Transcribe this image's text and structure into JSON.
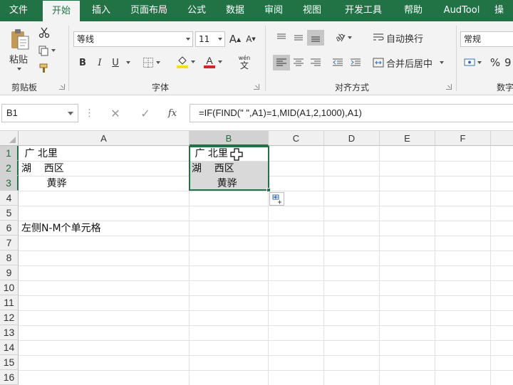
{
  "tabs": [
    {
      "label": "文件",
      "active": false
    },
    {
      "label": "开始",
      "active": true
    },
    {
      "label": "插入",
      "active": false
    },
    {
      "label": "页面布局",
      "active": false
    },
    {
      "label": "公式",
      "active": false
    },
    {
      "label": "数据",
      "active": false
    },
    {
      "label": "审阅",
      "active": false
    },
    {
      "label": "视图",
      "active": false
    },
    {
      "label": "开发工具",
      "active": false
    },
    {
      "label": "帮助",
      "active": false
    },
    {
      "label": "AudTool",
      "active": false
    },
    {
      "label": "操",
      "active": false
    }
  ],
  "ribbon": {
    "clipboard": {
      "paste_label": "粘贴",
      "group_label": "剪贴板"
    },
    "font": {
      "font_name": "等线",
      "font_size": "11",
      "bold": "B",
      "italic": "I",
      "underline": "U",
      "wen_top": "wén",
      "wen_bottom": "文",
      "increase_font": "A",
      "decrease_font": "A",
      "group_label": "字体"
    },
    "alignment": {
      "wrap_text": "自动换行",
      "merge_center": "合并后居中",
      "group_label": "对齐方式"
    },
    "number": {
      "format": "常规",
      "percent": "%",
      "comma": "9",
      "group_label": "数字"
    }
  },
  "formula_bar": {
    "name_box": "B1",
    "cancel": "✕",
    "confirm": "✓",
    "fx": "fx",
    "formula": "=IF(FIND(\" \",A1)=1,MID(A1,2,1000),A1)"
  },
  "sheet": {
    "columns": [
      "A",
      "B",
      "C",
      "D",
      "E",
      "F"
    ],
    "selected_column": "B",
    "rows": [
      "1",
      "2",
      "3",
      "4",
      "5",
      "6",
      "7",
      "8",
      "9",
      "10",
      "11",
      "12",
      "13",
      "14",
      "15",
      "16"
    ],
    "selected_rows": [
      "1",
      "2",
      "3"
    ],
    "cells": {
      "A1": " 广 北里",
      "A2": "湖    西区",
      "A3": "        黄骅",
      "A6": "左侧N-M个单元格",
      "B1": " 广 北里",
      "B2": "湖    西区",
      "B3": "        黄骅"
    }
  },
  "colors": {
    "accent": "#217346",
    "selection_fill": "#d9d9d9",
    "font_color_bar": "#e02020",
    "fill_color_bar": "#ffe100"
  }
}
